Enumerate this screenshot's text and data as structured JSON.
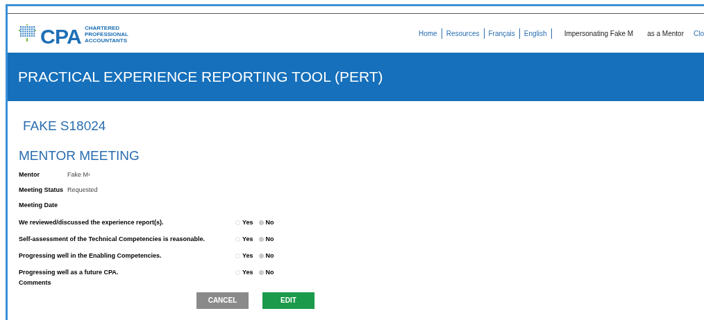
{
  "logo": {
    "wordmark": "CPA",
    "tagline": [
      "CHARTERED",
      "PROFESSIONAL",
      "ACCOUNTANTS"
    ]
  },
  "nav": {
    "links": [
      "Home",
      "Resources",
      "Français",
      "English"
    ],
    "impersonating": "Impersonating Fake M",
    "role": "as a Mentor",
    "close": "Clo"
  },
  "banner": {
    "title": "PRACTICAL EXPERIENCE REPORTING TOOL (PERT)"
  },
  "student": "FAKE S18024",
  "section": "MENTOR MEETING",
  "fields": [
    {
      "label": "Mentor",
      "value": "Fake M‹"
    },
    {
      "label": "Meeting Status",
      "value": "Requested"
    },
    {
      "label": "Meeting Date"
    }
  ],
  "questions": [
    {
      "text": "We reviewed/discussed the experience report(s).",
      "options": [
        {
          "label": "Yes",
          "selected": false
        },
        {
          "label": "No",
          "selected": true
        }
      ]
    },
    {
      "text": "Self-assessment of the Technical Competencies is reasonable.",
      "options": [
        {
          "label": "Yes",
          "selected": false
        },
        {
          "label": "No",
          "selected": true
        }
      ]
    },
    {
      "text": "Progressing well in the Enabling Competencies.",
      "options": [
        {
          "label": "Yes",
          "selected": false
        },
        {
          "label": "No",
          "selected": true
        }
      ]
    },
    {
      "text": "Progressing well as a future CPA.",
      "options": [
        {
          "label": "Yes",
          "selected": false
        },
        {
          "label": "No",
          "selected": true
        }
      ]
    }
  ],
  "comments_label": "Comments",
  "buttons": [
    {
      "label": "CANCEL",
      "kind": "secondary"
    },
    {
      "label": "EDIT",
      "kind": "primary"
    }
  ]
}
